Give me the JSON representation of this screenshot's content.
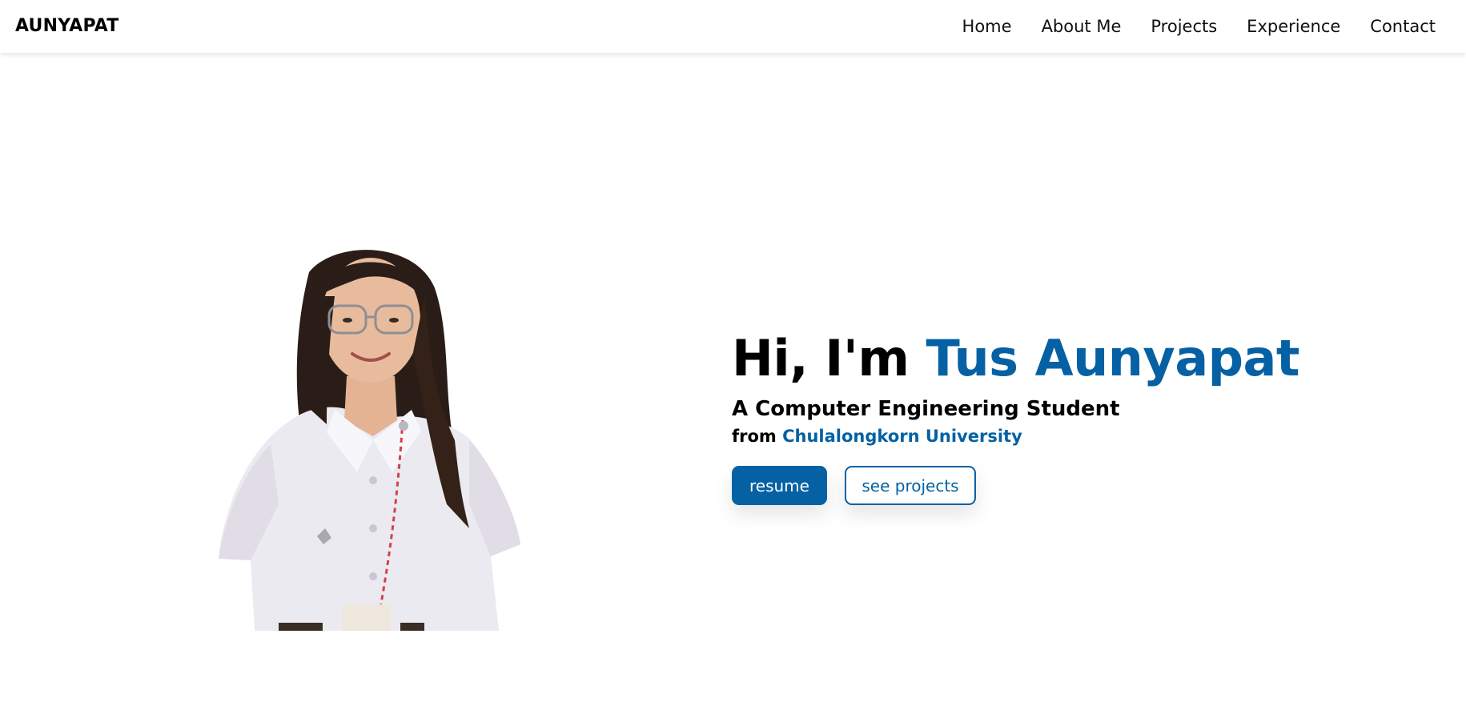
{
  "brand": "AUNYAPAT",
  "nav": {
    "items": [
      {
        "label": "Home"
      },
      {
        "label": "About Me"
      },
      {
        "label": "Projects"
      },
      {
        "label": "Experience"
      },
      {
        "label": "Contact"
      }
    ]
  },
  "hero": {
    "greeting_prefix": "Hi, I'm ",
    "name": "Tus Aunyapat",
    "subtitle": "A Computer Engineering Student",
    "from_prefix": "from ",
    "university": "Chulalongkorn University",
    "resume_label": "resume",
    "projects_label": "see projects"
  },
  "colors": {
    "accent": "#0561a3",
    "text": "#000000",
    "background": "#ffffff"
  }
}
